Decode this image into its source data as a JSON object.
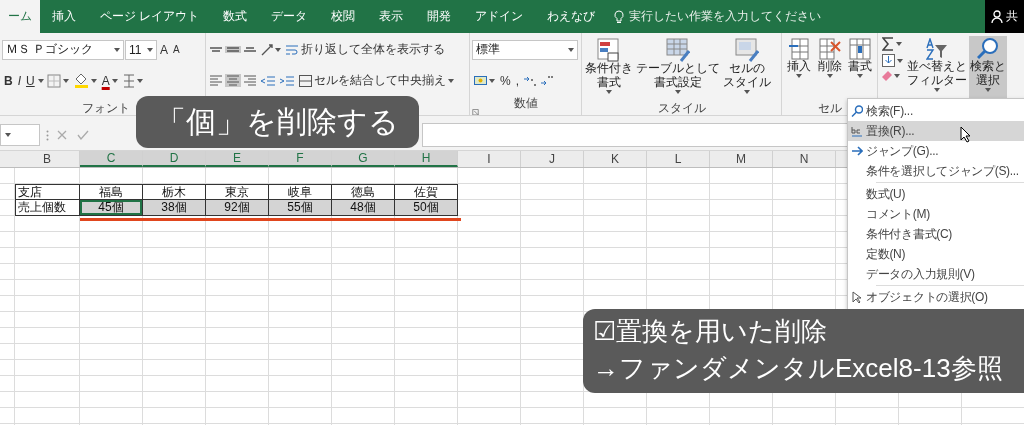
{
  "ribbon_tabs": [
    {
      "label": "ーム",
      "selected": true
    },
    {
      "label": "挿入",
      "selected": false
    },
    {
      "label": "ページ レイアウト",
      "selected": false
    },
    {
      "label": "数式",
      "selected": false
    },
    {
      "label": "データ",
      "selected": false
    },
    {
      "label": "校閲",
      "selected": false
    },
    {
      "label": "表示",
      "selected": false
    },
    {
      "label": "開発",
      "selected": false
    },
    {
      "label": "アドイン",
      "selected": false
    },
    {
      "label": "わえなび",
      "selected": false
    }
  ],
  "tell_me": {
    "placeholder": "実行したい作業を入力してください"
  },
  "share": {
    "label": "共"
  },
  "ribbon": {
    "font": {
      "font_name": "ＭＳ Ｐゴシック",
      "font_size": "11",
      "grow": "A",
      "shrink": "A",
      "styles": [
        "B",
        "I",
        "U"
      ],
      "font_color": "A",
      "label": "フォント"
    },
    "alignment": {
      "wrap_text": "折り返して全体を表示する",
      "merge_center": "セルを結合して中央揃え"
    },
    "number": {
      "format": "標準",
      "symbols": [
        "%",
        ","
      ],
      "label": "数値"
    },
    "styles": {
      "buttons": [
        {
          "kind": "conditional",
          "lines": [
            "条件付き",
            "書式"
          ]
        },
        {
          "kind": "table",
          "lines": [
            "テーブルとして",
            "書式設定"
          ]
        },
        {
          "kind": "cellstyle",
          "lines": [
            "セルの",
            "スタイル"
          ]
        }
      ],
      "label": "スタイル"
    },
    "cells": {
      "buttons": [
        {
          "kind": "insert",
          "label": "挿入"
        },
        {
          "kind": "delete",
          "label": "削除"
        },
        {
          "kind": "format",
          "label": "書式"
        }
      ],
      "label": "セル"
    },
    "editing": {
      "buttons": [
        {
          "kind": "sort",
          "lines": [
            "並べ替えと",
            "フィルター"
          ],
          "pressed": false
        },
        {
          "kind": "find",
          "lines": [
            "検索と",
            "選択"
          ],
          "pressed": true
        }
      ]
    }
  },
  "sheet": {
    "columns": [
      {
        "label": "B",
        "selected": false
      },
      {
        "label": "C",
        "selected": true
      },
      {
        "label": "D",
        "selected": true
      },
      {
        "label": "E",
        "selected": true
      },
      {
        "label": "F",
        "selected": true
      },
      {
        "label": "G",
        "selected": true
      },
      {
        "label": "H",
        "selected": true
      },
      {
        "label": "I",
        "selected": false
      },
      {
        "label": "J",
        "selected": false
      },
      {
        "label": "K",
        "selected": false
      },
      {
        "label": "L",
        "selected": false
      },
      {
        "label": "M",
        "selected": false
      },
      {
        "label": "N",
        "selected": false
      }
    ],
    "rows": [
      {
        "cells": [
          {
            "text": "支店",
            "selected": false,
            "active": false
          },
          {
            "text": "福島",
            "selected": false,
            "active": false
          },
          {
            "text": "栃木",
            "selected": false,
            "active": false
          },
          {
            "text": "東京",
            "selected": false,
            "active": false
          },
          {
            "text": "岐阜",
            "selected": false,
            "active": false
          },
          {
            "text": "徳島",
            "selected": false,
            "active": false
          },
          {
            "text": "佐賀",
            "selected": false,
            "active": false
          }
        ]
      },
      {
        "cells": [
          {
            "text": "売上個数",
            "selected": false,
            "active": false
          },
          {
            "text": "45個",
            "selected": true,
            "active": true
          },
          {
            "text": "38個",
            "selected": true,
            "active": false
          },
          {
            "text": "92個",
            "selected": true,
            "active": false
          },
          {
            "text": "55個",
            "selected": true,
            "active": false
          },
          {
            "text": "48個",
            "selected": true,
            "active": false
          },
          {
            "text": "50個",
            "selected": true,
            "active": false
          }
        ]
      }
    ]
  },
  "menu": {
    "items": [
      {
        "kind": "search",
        "label": "検索(F)...",
        "highlighted": false
      },
      {
        "kind": "replace",
        "label": "置換(R)...",
        "highlighted": true
      },
      {
        "kind": "goto",
        "label": "ジャンプ(G)...",
        "highlighted": false
      },
      {
        "kind": "plain",
        "label": "条件を選択してジャンプ(S)...",
        "highlighted": false
      },
      {
        "kind": "separator"
      },
      {
        "kind": "plain",
        "label": "数式(U)",
        "highlighted": false
      },
      {
        "kind": "plain",
        "label": "コメント(M)",
        "highlighted": false
      },
      {
        "kind": "plain",
        "label": "条件付き書式(C)",
        "highlighted": false
      },
      {
        "kind": "plain",
        "label": "定数(N)",
        "highlighted": false
      },
      {
        "kind": "plain",
        "label": "データの入力規則(V)",
        "highlighted": false
      },
      {
        "kind": "separator"
      },
      {
        "kind": "select",
        "label": "オブジェクトの選択(O)",
        "highlighted": false
      }
    ]
  },
  "caption_top": {
    "text": "「個」を削除する"
  },
  "caption_bottom": {
    "lines": [
      "☑置換を用いた削除",
      "→ファンダメンタルExcel8-13参照"
    ]
  }
}
